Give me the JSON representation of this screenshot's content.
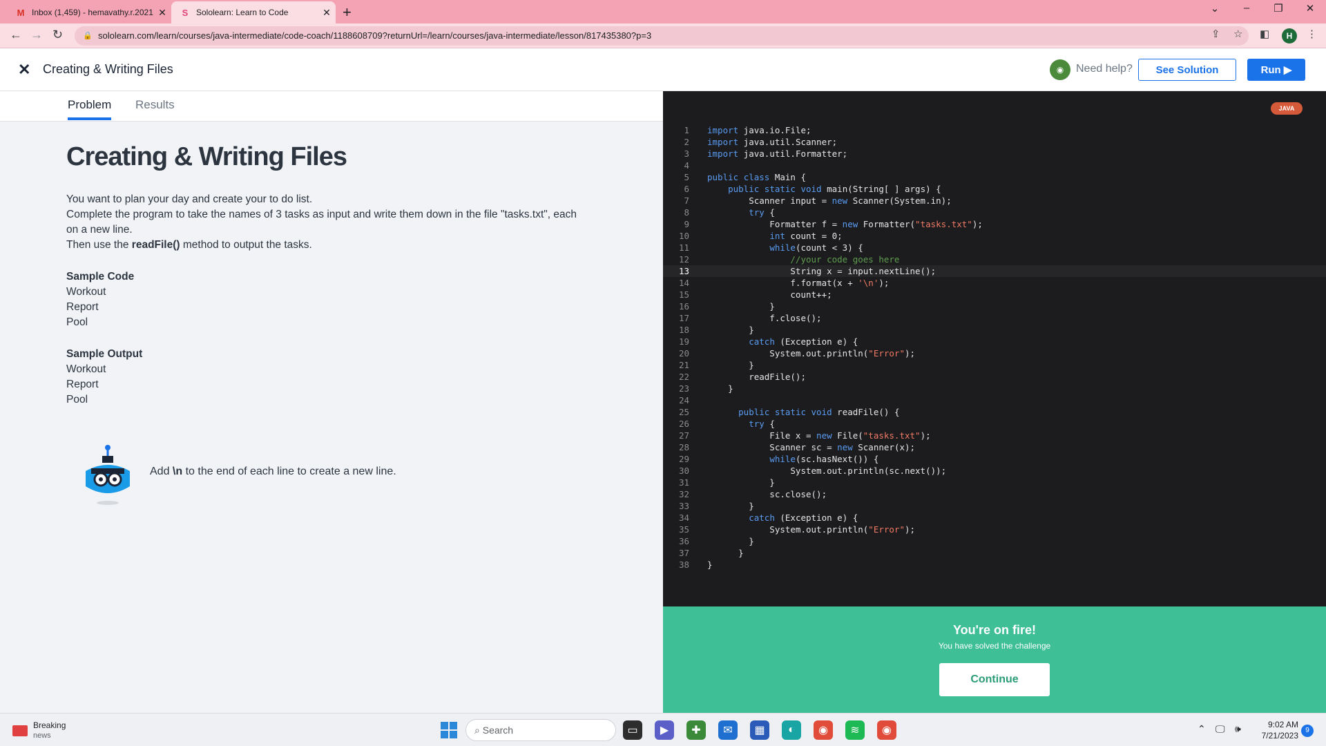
{
  "browser": {
    "tabs": [
      {
        "title": "Inbox (1,459) - hemavathy.r.2021",
        "close": "✕"
      },
      {
        "title": "Sololearn: Learn to Code",
        "close": "✕"
      }
    ],
    "new_tab": "+",
    "url": "sololearn.com/learn/courses/java-intermediate/code-coach/1188608709?returnUrl=/learn/courses/java-intermediate/lesson/817435380?p=3",
    "profile_initial": "H"
  },
  "header": {
    "title": "Creating & Writing Files",
    "need_help": "Need help?",
    "see_solution": "See Solution",
    "run": "Run ▶"
  },
  "tabs": {
    "problem": "Problem",
    "results": "Results"
  },
  "problem": {
    "title": "Creating & Writing Files",
    "line1": "You want to plan your day and create your to do list.",
    "line2": "Complete the program to take the names of 3 tasks as input and write them down in the file \"tasks.txt\", each on a new line.",
    "line3a": "Then use the ",
    "line3b": "readFile()",
    "line3c": " method to output the tasks.",
    "sample_code_label": "Sample Code",
    "sample_code": [
      "Workout",
      "Report",
      "Pool"
    ],
    "sample_output_label": "Sample Output",
    "sample_output": [
      "Workout",
      "Report",
      "Pool"
    ],
    "hint_a": "Add ",
    "hint_b": "\\n",
    "hint_c": " to the end of each line to create a new line."
  },
  "editor": {
    "language": "JAVA",
    "current_line": 13,
    "lines": [
      "import java.io.File;",
      "import java.util.Scanner;",
      "import java.util.Formatter;",
      "",
      "public class Main {",
      "    public static void main(String[ ] args) {",
      "        Scanner input = new Scanner(System.in);",
      "        try {",
      "            Formatter f = new Formatter(\"tasks.txt\");",
      "            int count = 0;",
      "            while(count < 3) {",
      "                //your code goes here",
      "                String x = input.nextLine();",
      "                f.format(x + '\\n');",
      "                count++;",
      "            }",
      "            f.close();",
      "        }",
      "        catch (Exception e) {",
      "            System.out.println(\"Error\");",
      "        }",
      "        readFile();",
      "    }",
      "",
      "      public static void readFile() {",
      "        try {",
      "            File x = new File(\"tasks.txt\");",
      "            Scanner sc = new Scanner(x);",
      "            while(sc.hasNext()) {",
      "                System.out.println(sc.next());",
      "            }",
      "            sc.close();",
      "        }",
      "        catch (Exception e) {",
      "            System.out.println(\"Error\");",
      "        }",
      "      }",
      "}"
    ]
  },
  "success": {
    "title": "You're on fire!",
    "subtitle": "You have solved the challenge",
    "continue": "Continue"
  },
  "taskbar": {
    "news_title": "Breaking",
    "news_sub": "news",
    "search_placeholder": "Search",
    "time": "9:02 AM",
    "date": "7/21/2023",
    "notifications": "9"
  },
  "colors": {
    "accent": "#1a73e8",
    "success": "#3ebf95",
    "editor_bg": "#1c1c1e",
    "tab_bar": "#f4a3b4"
  }
}
